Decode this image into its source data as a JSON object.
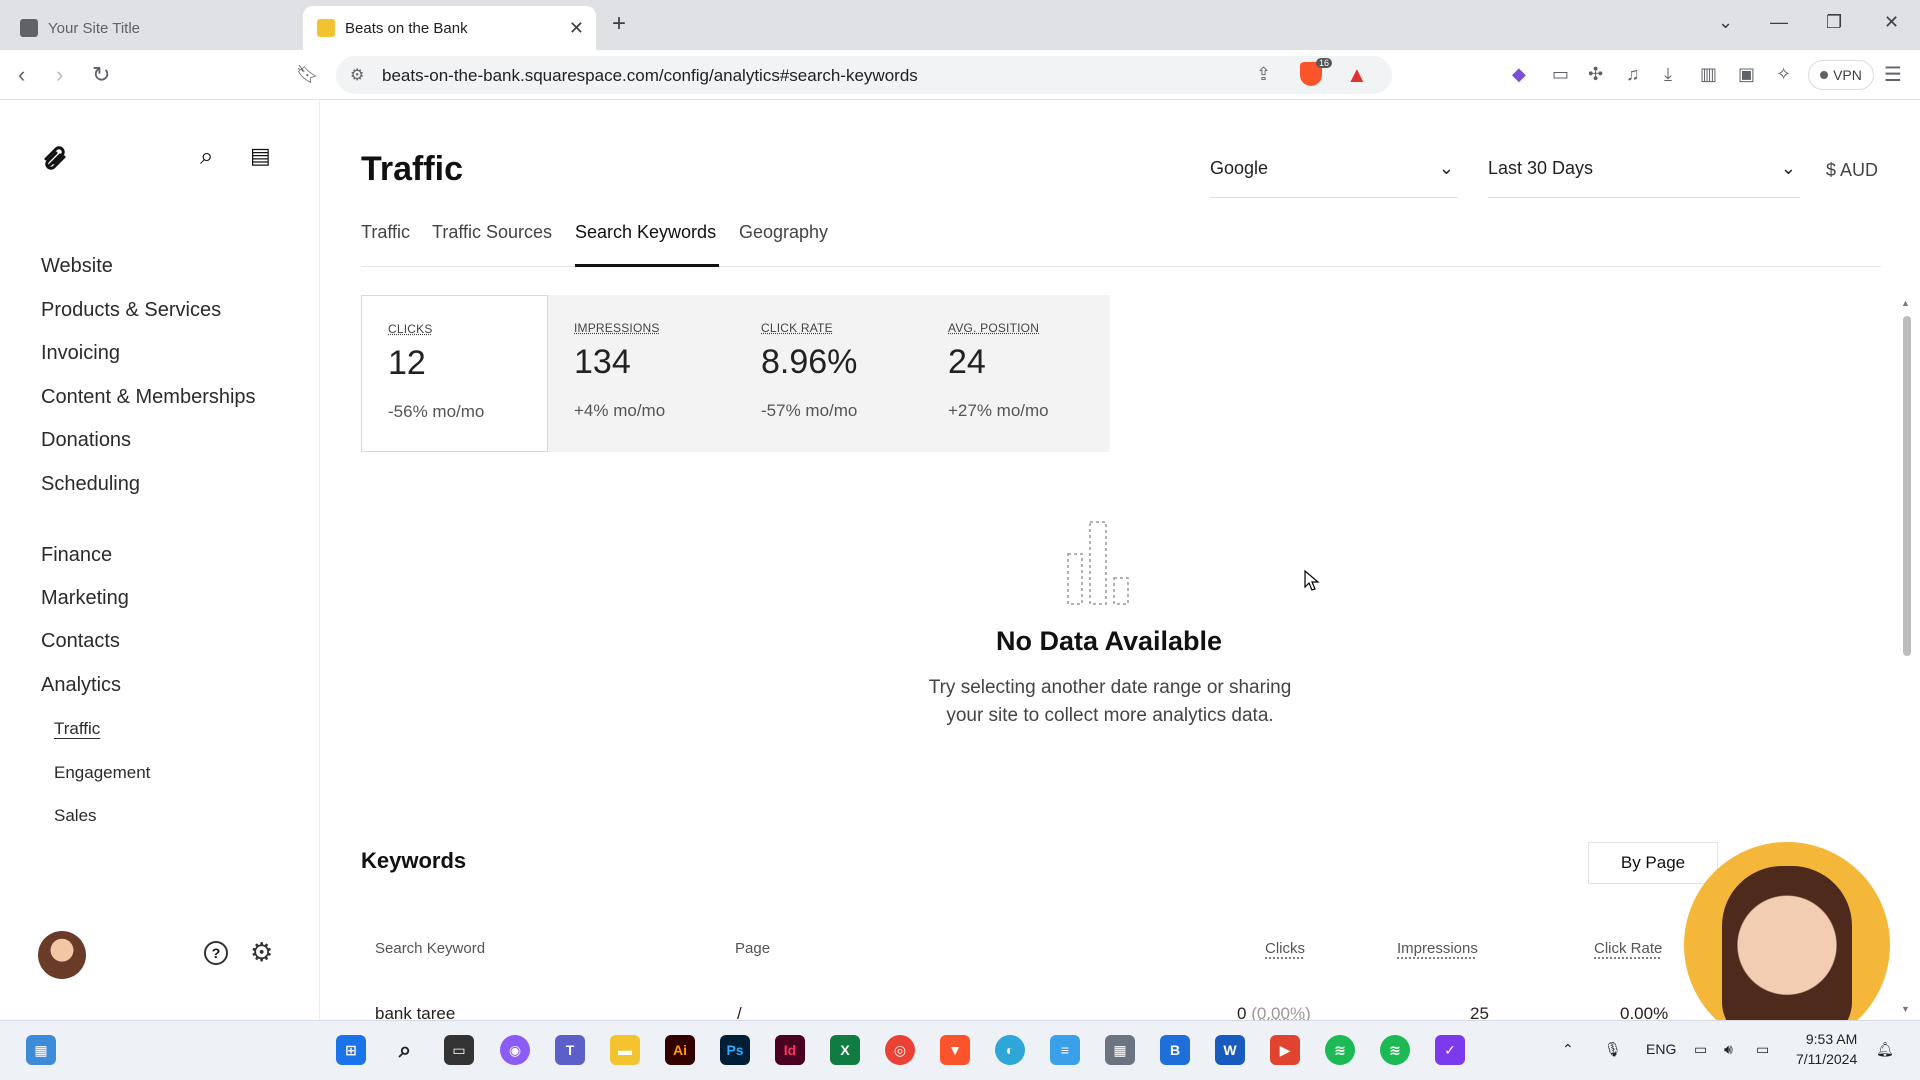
{
  "browser": {
    "tabs": [
      {
        "title": "Your Site Title"
      },
      {
        "title": "Beats on the Bank"
      }
    ],
    "url": "beats-on-the-bank.squarespace.com/config/analytics#search-keywords",
    "vpn_label": "VPN",
    "brave_badge": "16"
  },
  "sidebar": {
    "main_items": [
      {
        "label": "Website"
      },
      {
        "label": "Products & Services"
      },
      {
        "label": "Invoicing"
      },
      {
        "label": "Content & Memberships"
      },
      {
        "label": "Donations"
      },
      {
        "label": "Scheduling"
      }
    ],
    "section_items": [
      {
        "label": "Finance"
      },
      {
        "label": "Marketing"
      },
      {
        "label": "Contacts"
      },
      {
        "label": "Analytics"
      }
    ],
    "analytics_sub": [
      {
        "label": "Traffic"
      },
      {
        "label": "Engagement"
      },
      {
        "label": "Sales"
      }
    ]
  },
  "header": {
    "title": "Traffic",
    "source_select": "Google",
    "range_select": "Last 30 Days",
    "currency": "$ AUD"
  },
  "subtabs": [
    {
      "label": "Traffic"
    },
    {
      "label": "Traffic Sources"
    },
    {
      "label": "Search Keywords"
    },
    {
      "label": "Geography"
    }
  ],
  "stats": [
    {
      "label": "CLICKS",
      "value": "12",
      "change": "-56% mo/mo"
    },
    {
      "label": "IMPRESSIONS",
      "value": "134",
      "change": "+4% mo/mo"
    },
    {
      "label": "CLICK RATE",
      "value": "8.96%",
      "change": "-57% mo/mo"
    },
    {
      "label": "AVG. POSITION",
      "value": "24",
      "change": "+27% mo/mo"
    }
  ],
  "empty_state": {
    "title": "No Data Available",
    "line1": "Try selecting another date range or sharing",
    "line2": "your site to collect more analytics data."
  },
  "keywords": {
    "title": "Keywords",
    "toggle": "By Page",
    "columns": {
      "keyword": "Search Keyword",
      "page": "Page",
      "clicks": "Clicks",
      "impressions": "Impressions",
      "click_rate": "Click Rate"
    },
    "rows": [
      {
        "keyword": "bank taree",
        "page": "/",
        "clicks": "0",
        "clicks_pct": "(0.00%)",
        "impressions": "25",
        "click_rate": "0.00%"
      }
    ]
  },
  "taskbar": {
    "language": "ENG",
    "time": "9:53 AM",
    "date": "7/11/2024"
  }
}
